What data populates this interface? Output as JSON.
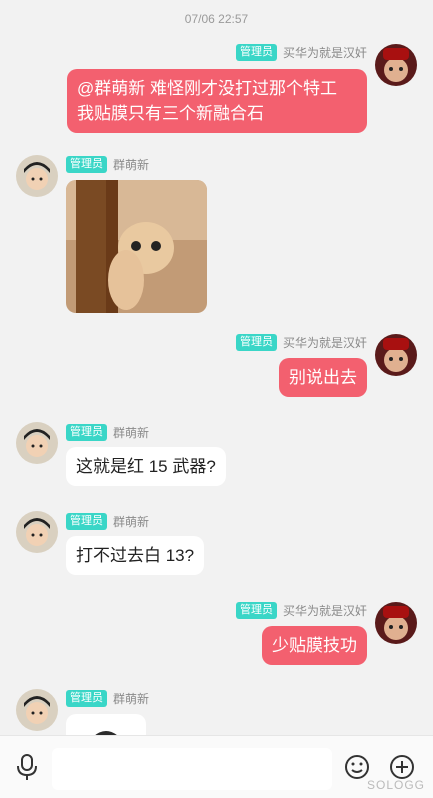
{
  "timestamp": "07/06 22:57",
  "badge_label": "管理员",
  "messages": [
    {
      "sender": "买华为就是汉奸",
      "text": "@群萌新 难怪刚才没打过那个特工\n我贴膜只有三个新融合石"
    },
    {
      "sender": "群萌新",
      "image": "cat-peeking-image"
    },
    {
      "sender": "买华为就是汉奸",
      "text": "别说出去"
    },
    {
      "sender": "群萌新",
      "text": "这就是红 15 武器?"
    },
    {
      "sender": "群萌新",
      "text": "打不过去白 13?"
    },
    {
      "sender": "买华为就是汉奸",
      "text": "少贴膜技功"
    },
    {
      "sender": "群萌新",
      "image": "avatar-sticker-image"
    }
  ],
  "composer": {
    "voice_icon": "microphone-icon",
    "emoji_icon": "emoji-icon",
    "plus_icon": "plus-circle-icon"
  },
  "watermark": "SOLOGG"
}
